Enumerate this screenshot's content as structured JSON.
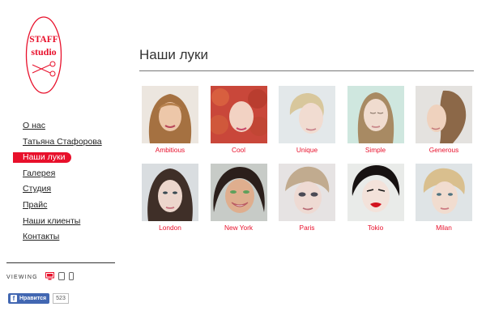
{
  "brand": {
    "logo_line1": "STAFF",
    "logo_line2": "studio"
  },
  "nav": {
    "items": [
      {
        "label": "О нас"
      },
      {
        "label": "Татьяна Стафорова"
      },
      {
        "label": "Наши луки"
      },
      {
        "label": "Галерея"
      },
      {
        "label": "Студия"
      },
      {
        "label": "Прайс"
      },
      {
        "label": "Наши клиенты"
      },
      {
        "label": "Контакты"
      }
    ],
    "active_label": "Наши луки"
  },
  "viewing": {
    "label": "VIEWING",
    "devices": [
      "desktop-icon",
      "tablet-icon",
      "phone-icon"
    ],
    "active_device": "desktop-icon"
  },
  "facebook": {
    "like_label": "Нравится",
    "count": "523"
  },
  "main": {
    "title": "Наши луки"
  },
  "looks": [
    {
      "label": "Ambitious"
    },
    {
      "label": "Cool"
    },
    {
      "label": "Unique"
    },
    {
      "label": "Simple"
    },
    {
      "label": "Generous"
    },
    {
      "label": "London"
    },
    {
      "label": "New York"
    },
    {
      "label": "Paris"
    },
    {
      "label": "Tokio"
    },
    {
      "label": "Milan"
    }
  ],
  "colors": {
    "accent": "#e8102b",
    "facebook": "#4267b2",
    "text": "#333333"
  }
}
